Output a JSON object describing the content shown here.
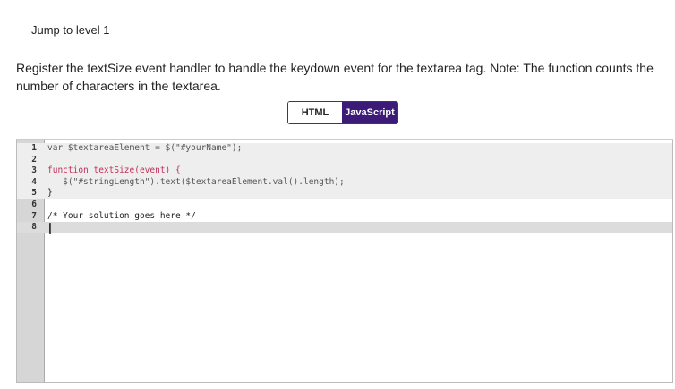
{
  "jump_link": "Jump to level 1",
  "instructions": "Register the textSize event handler to handle the keydown event for the textarea tag. Note: The function counts the number of characters in the textarea.",
  "tabs": {
    "html": "HTML",
    "javascript": "JavaScript",
    "active": "JavaScript"
  },
  "editor": {
    "lines": [
      {
        "n": "1",
        "text": "var $textareaElement = $(\"#yourName\");",
        "readonly": true
      },
      {
        "n": "2",
        "text": "",
        "readonly": true
      },
      {
        "n": "3",
        "text": "function textSize(event) {",
        "readonly": true
      },
      {
        "n": "4",
        "text": "   $(\"#stringLength\").text($textareaElement.val().length);",
        "readonly": true
      },
      {
        "n": "5",
        "text": "}",
        "readonly": true
      },
      {
        "n": "6",
        "text": "",
        "readonly": false
      },
      {
        "n": "7",
        "text": "/* Your solution goes here */",
        "readonly": false
      },
      {
        "n": "8",
        "text": "",
        "readonly": false
      }
    ]
  }
}
